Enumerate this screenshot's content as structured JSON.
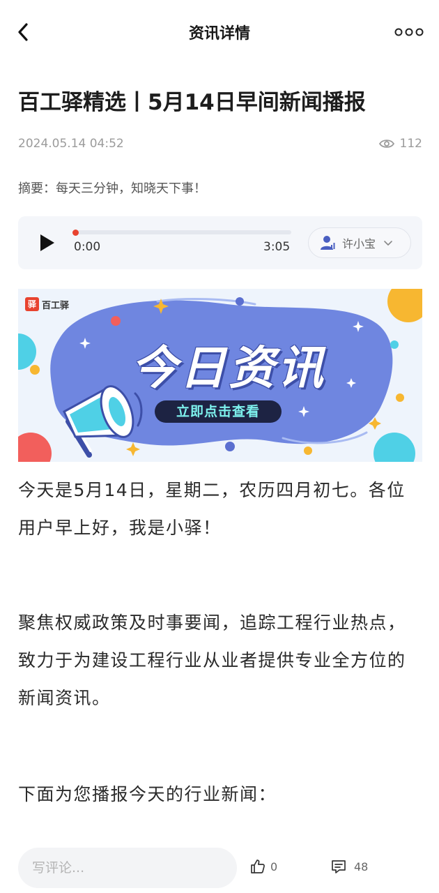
{
  "header": {
    "title": "资讯详情"
  },
  "article": {
    "title": "百工驿精选丨5月14日早间新闻播报",
    "date": "2024.05.14 04:52",
    "views": "112",
    "summary": "摘要：每天三分钟，知晓天下事！"
  },
  "audio": {
    "current_time": "0:00",
    "total_time": "3:05",
    "progress": 0,
    "voice": "许小宝"
  },
  "banner": {
    "logo_mark": "驿",
    "logo_text": "百工驿",
    "title": "今日资讯",
    "cta": "立即点击查看"
  },
  "body": {
    "paragraphs": [
      "今天是5月14日，星期二，农历四月初七。各位用户早上好，我是小驿！",
      "聚焦权威政策及时事要闻，追踪工程行业热点，致力于为建设工程行业从业者提供专业全方位的新闻资讯。",
      "下面为您播报今天的行业新闻："
    ]
  },
  "bottom_bar": {
    "comment_placeholder": "写评论...",
    "likes": "0",
    "comments": "48"
  },
  "colors": {
    "accent_red": "#e8432f",
    "banner_blue": "#6f86e0",
    "banner_cta_bg": "#1d2343",
    "banner_cta_text": "#7ef2ee"
  },
  "icons": [
    "back-icon",
    "more-icon",
    "eye-icon",
    "play-icon",
    "person-icon",
    "chevron-down-icon",
    "megaphone-icon",
    "thumbs-up-icon",
    "comment-icon"
  ]
}
